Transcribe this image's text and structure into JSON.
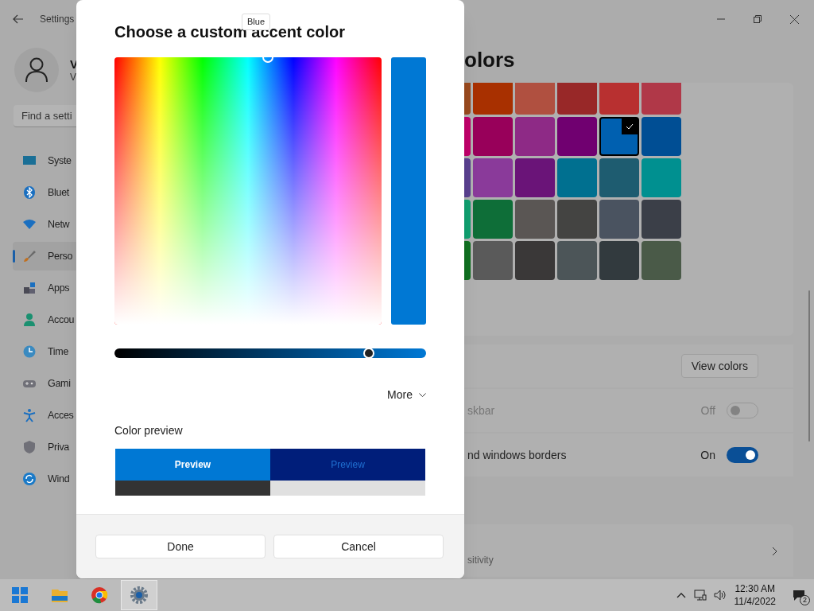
{
  "settings_window": {
    "title": "Settings",
    "user": {
      "name": "V",
      "email": "V"
    },
    "search": {
      "placeholder": "Find a setti"
    },
    "nav_items": [
      {
        "label": "Syste",
        "selected": false
      },
      {
        "label": "Bluet",
        "selected": false
      },
      {
        "label": "Netw",
        "selected": false
      },
      {
        "label": "Perso",
        "selected": true
      },
      {
        "label": "Apps",
        "selected": false
      },
      {
        "label": "Accou",
        "selected": false
      },
      {
        "label": "Time",
        "selected": false
      },
      {
        "label": "Gami",
        "selected": false
      },
      {
        "label": "Acces",
        "selected": false
      },
      {
        "label": "Priva",
        "selected": false
      },
      {
        "label": "Wind",
        "selected": false
      }
    ],
    "page_title": "olors",
    "accent_swatches": [
      [
        {
          "color": "#9a4a1e",
          "selected": false
        },
        {
          "color": "#a83000",
          "selected": false
        },
        {
          "color": "#b05040",
          "selected": false
        },
        {
          "color": "#982828",
          "selected": false
        },
        {
          "color": "#b83030",
          "selected": false
        },
        {
          "color": "#b03848",
          "selected": false
        }
      ],
      [
        {
          "color": "#c0006a",
          "selected": false
        },
        {
          "color": "#98005a",
          "selected": false
        },
        {
          "color": "#8e2a86",
          "selected": false
        },
        {
          "color": "#700070",
          "selected": false
        },
        {
          "color": "#0060b0",
          "selected": true
        },
        {
          "color": "#004e94",
          "selected": false
        }
      ],
      [
        {
          "color": "#5a4090",
          "selected": false
        },
        {
          "color": "#8a3a9a",
          "selected": false
        },
        {
          "color": "#6a1478",
          "selected": false
        },
        {
          "color": "#007090",
          "selected": false
        },
        {
          "color": "#1e5c70",
          "selected": false
        },
        {
          "color": "#009090",
          "selected": false
        }
      ],
      [
        {
          "color": "#10a070",
          "selected": false
        },
        {
          "color": "#0e6e38",
          "selected": false
        },
        {
          "color": "#5a5654",
          "selected": false
        },
        {
          "color": "#444442",
          "selected": false
        },
        {
          "color": "#4a5360",
          "selected": false
        },
        {
          "color": "#3b3f48",
          "selected": false
        }
      ],
      [
        {
          "color": "#107020",
          "selected": false
        },
        {
          "color": "#5a5a5a",
          "selected": false
        },
        {
          "color": "#3a3838",
          "selected": false
        },
        {
          "color": "#4c5558",
          "selected": false
        },
        {
          "color": "#323a3e",
          "selected": false
        },
        {
          "color": "#4a5a48",
          "selected": false
        }
      ]
    ],
    "rows": [
      {
        "kind": "button",
        "button": "View colors"
      },
      {
        "kind": "toggle",
        "label": "skbar",
        "state_label": "Off",
        "on": false,
        "disabled": true
      },
      {
        "kind": "toggle",
        "label": "nd windows borders",
        "state_label": "On",
        "on": true,
        "disabled": false
      }
    ],
    "link_row": {
      "label": "sitivity"
    }
  },
  "dialog": {
    "title": "Choose a custom accent color",
    "tooltip": "Blue",
    "preview_bar": {
      "color": "#0078d4"
    },
    "brightness": {
      "level": 0.816
    },
    "more_button": "More",
    "preview_label": "Color preview",
    "preview_tiles": [
      {
        "text": "Preview",
        "color": "#0078d4"
      },
      {
        "text": "Preview",
        "color": "#001e7a"
      },
      {
        "color": "#333333"
      },
      {
        "color": "#e0e0e0"
      }
    ],
    "buttons": [
      "Done",
      "Cancel"
    ]
  },
  "taskbar": {
    "apps": [
      {
        "kind": "start",
        "selected": false
      },
      {
        "kind": "folder",
        "selected": false
      },
      {
        "kind": "browser",
        "selected": false
      },
      {
        "kind": "settings",
        "selected": true
      }
    ],
    "clock_time": "12:30 AM",
    "clock_date": "11/4/2022",
    "notification_count": "2"
  }
}
